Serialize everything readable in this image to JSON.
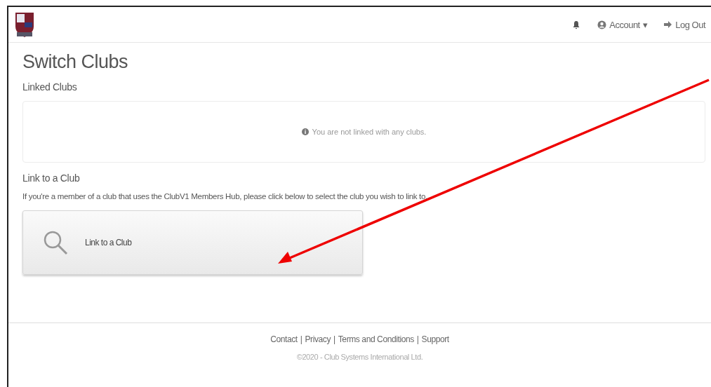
{
  "navbar": {
    "items": [
      {
        "kind": "bell"
      },
      {
        "kind": "account",
        "label": "Account",
        "caret": "▾"
      },
      {
        "kind": "logout",
        "label": "Log Out"
      }
    ]
  },
  "page_title": "Switch Clubs",
  "linked_clubs": {
    "heading": "Linked Clubs",
    "message": "You are not linked with any clubs."
  },
  "link_section": {
    "heading": "Link to a Club",
    "description": "If you're a member of a club that uses the ClubV1 Members Hub, please click below to select the club you wish to link to.",
    "button": "Link to a Club"
  },
  "footer": {
    "links": [
      "Contact",
      "Privacy",
      "Terms and Conditions",
      "Support"
    ],
    "separator": "|",
    "copyright": "©2020 - Club Systems International Ltd."
  }
}
